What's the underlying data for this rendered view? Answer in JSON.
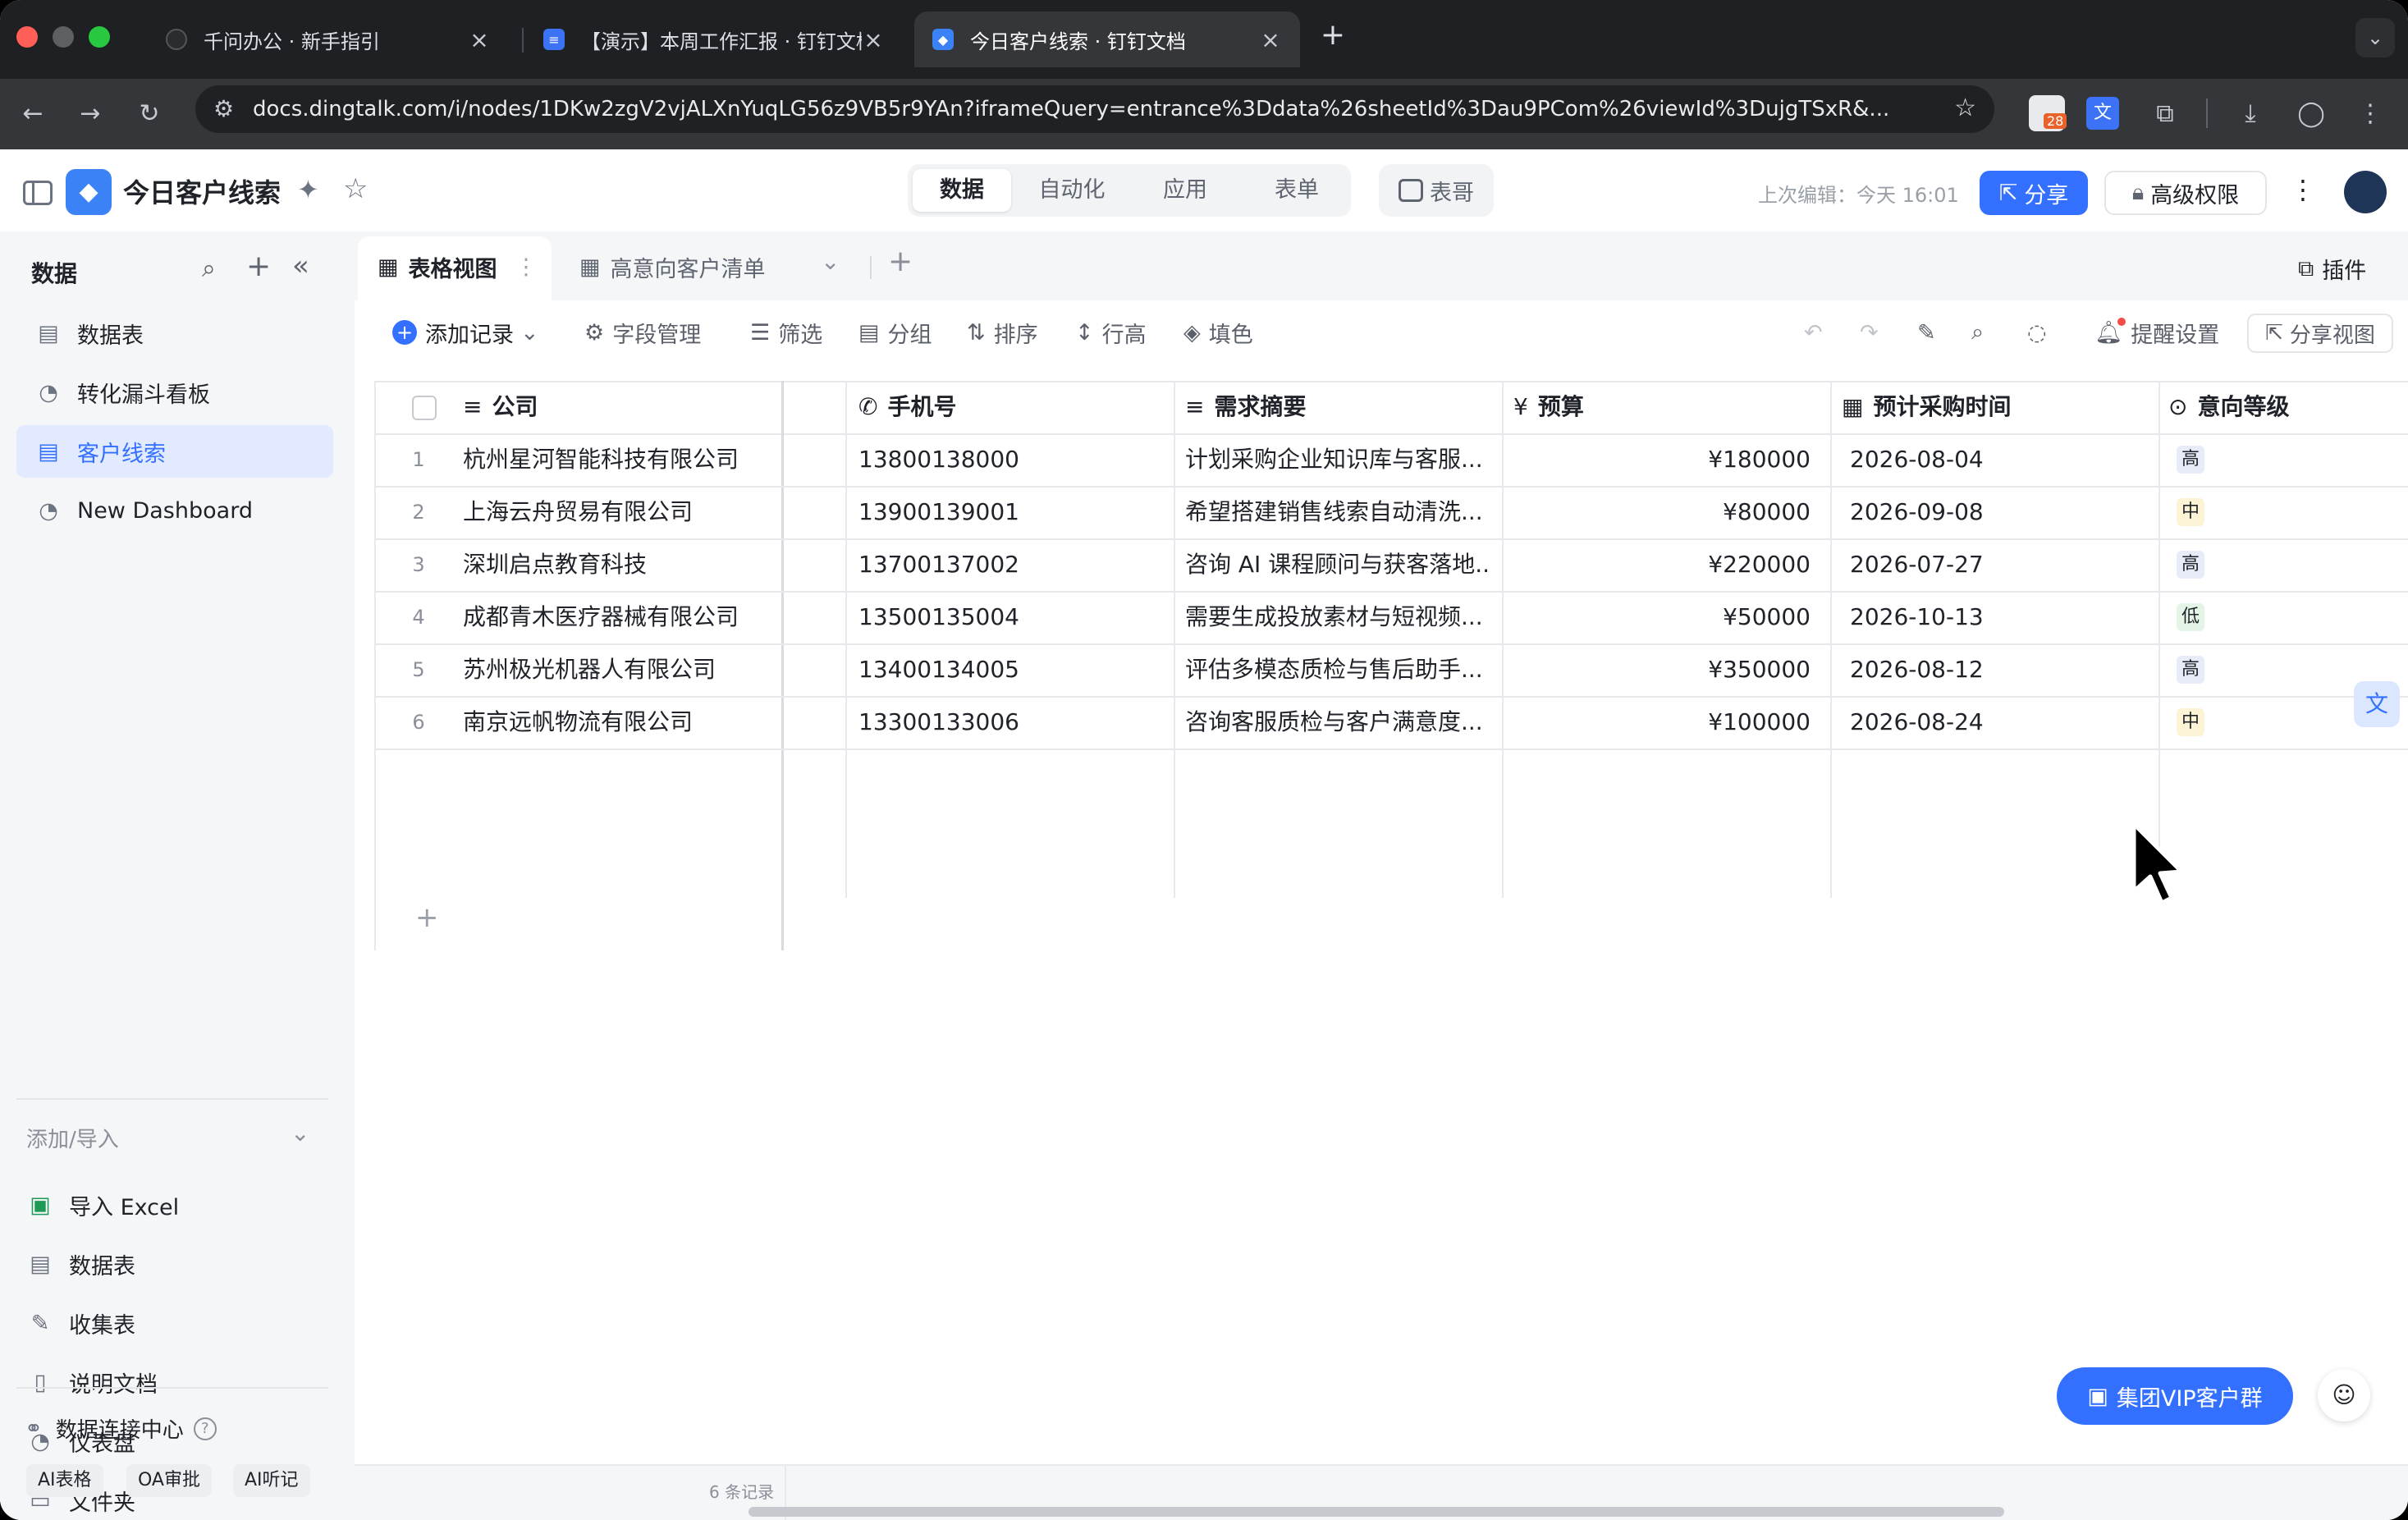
{
  "browser": {
    "tabs": [
      {
        "title": "千问办公 · 新手指引",
        "icon": "swirl-icon"
      },
      {
        "title": "【演示】本周工作汇报 · 钉钉文档",
        "icon": "doc-icon"
      },
      {
        "title": "今日客户线索 · 钉钉文档",
        "icon": "dingtalk-icon"
      }
    ],
    "url": "docs.dingtalk.com/i/nodes/1DKw2zgV2vjALXnYuqLG56z9VB5r9YAn?iframeQuery=entrance%3Ddata%26sheetId%3Dau9PCom%26viewId%3DujgTSxR&...",
    "badge_count": "28"
  },
  "header": {
    "doc_title": "今日客户线索",
    "tabs": [
      "数据",
      "自动化",
      "应用",
      "表单"
    ],
    "active_tab": "数据",
    "assistant": "表哥",
    "last_edit": "上次编辑：今天 16:01",
    "share": "分享",
    "permissions": "高级权限"
  },
  "sidebar": {
    "title": "数据",
    "items": [
      {
        "label": "数据表",
        "icon": "table-icon"
      },
      {
        "label": "转化漏斗看板",
        "icon": "dashboard-icon"
      },
      {
        "label": "客户线索",
        "icon": "table-icon"
      },
      {
        "label": "New Dashboard",
        "icon": "dashboard-icon"
      }
    ],
    "active_item": "客户线索",
    "add_import": "添加/导入",
    "import_items": [
      {
        "label": "导入 Excel",
        "icon": "excel-icon"
      },
      {
        "label": "数据表",
        "icon": "table-icon"
      },
      {
        "label": "收集表",
        "icon": "form-icon"
      },
      {
        "label": "说明文档",
        "icon": "doc-icon"
      },
      {
        "label": "仪表盘",
        "icon": "dashboard-icon"
      },
      {
        "label": "文件夹",
        "icon": "folder-icon"
      }
    ],
    "data_hub": "数据连接中心",
    "chips": [
      "AI表格",
      "OA审批",
      "AI听记"
    ]
  },
  "views": {
    "items": [
      "表格视图",
      "高意向客户清单"
    ],
    "active": "表格视图",
    "plugin": "插件"
  },
  "toolbar": {
    "add_record": "添加记录",
    "fields": "字段管理",
    "filter": "筛选",
    "group": "分组",
    "sort": "排序",
    "row_height": "行高",
    "fill": "填色",
    "reminder": "提醒设置",
    "share_view": "分享视图"
  },
  "grid": {
    "columns": [
      "公司",
      "手机号",
      "需求摘要",
      "预算",
      "预计采购时间",
      "意向等级"
    ],
    "rows": [
      {
        "n": "1",
        "company": "杭州星河智能科技有限公司",
        "phone": "13800138000",
        "summary": "计划采购企业知识库与客服...",
        "budget": "¥180000",
        "date": "2026-08-04",
        "level": "高"
      },
      {
        "n": "2",
        "company": "上海云舟贸易有限公司",
        "phone": "13900139001",
        "summary": "希望搭建销售线索自动清洗...",
        "budget": "¥80000",
        "date": "2026-09-08",
        "level": "中"
      },
      {
        "n": "3",
        "company": "深圳启点教育科技",
        "phone": "13700137002",
        "summary": "咨询 AI 课程顾问与获客落地...",
        "budget": "¥220000",
        "date": "2026-07-27",
        "level": "高"
      },
      {
        "n": "4",
        "company": "成都青木医疗器械有限公司",
        "phone": "13500135004",
        "summary": "需要生成投放素材与短视频...",
        "budget": "¥50000",
        "date": "2026-10-13",
        "level": "低"
      },
      {
        "n": "5",
        "company": "苏州极光机器人有限公司",
        "phone": "13400134005",
        "summary": "评估多模态质检与售后助手...",
        "budget": "¥350000",
        "date": "2026-08-12",
        "level": "高"
      },
      {
        "n": "6",
        "company": "南京远帆物流有限公司",
        "phone": "13300133006",
        "summary": "咨询客服质检与客户满意度...",
        "budget": "¥100000",
        "date": "2026-08-24",
        "level": "中"
      }
    ],
    "record_count": "6 条记录"
  },
  "level_colors": {
    "高": "#e8ebf8",
    "中": "#fdf4d6",
    "低": "#e4f4e6"
  },
  "vip_group": "集团VIP客户群",
  "accent": "#3370ff"
}
